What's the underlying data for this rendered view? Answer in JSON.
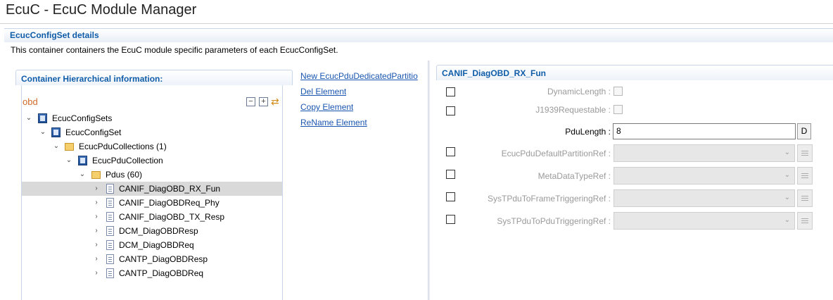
{
  "app_title": "EcuC - EcuC Module Manager",
  "details": {
    "title": "EcucConfigSet details",
    "description": "This container containers the EcuC module specific parameters of each EcucConfigSet."
  },
  "hierarchy": {
    "title": "Container Hierarchical information:",
    "filter": "obd",
    "tree": [
      {
        "label": "EcucConfigSets",
        "icon": "container-icon",
        "twisty": "expanded"
      },
      {
        "label": "EcucConfigSet",
        "icon": "container-icon",
        "twisty": "expanded"
      },
      {
        "label": "EcucPduCollections (1)",
        "icon": "folder-icon",
        "twisty": "expanded"
      },
      {
        "label": "EcucPduCollection",
        "icon": "container-icon",
        "twisty": "expanded"
      },
      {
        "label": "Pdus (60)",
        "icon": "folder-icon",
        "twisty": "expanded"
      },
      {
        "label": "CANIF_DiagOBD_RX_Fun",
        "icon": "document-icon",
        "twisty": "collapsed",
        "selected": true
      },
      {
        "label": "CANIF_DiagOBDReq_Phy",
        "icon": "document-icon",
        "twisty": "collapsed"
      },
      {
        "label": "CANIF_DiagOBD_TX_Resp",
        "icon": "document-icon",
        "twisty": "collapsed"
      },
      {
        "label": "DCM_DiagOBDResp",
        "icon": "document-icon",
        "twisty": "collapsed"
      },
      {
        "label": "DCM_DiagOBDReq",
        "icon": "document-icon",
        "twisty": "collapsed"
      },
      {
        "label": "CANTP_DiagOBDResp",
        "icon": "document-icon",
        "twisty": "collapsed"
      },
      {
        "label": "CANTP_DiagOBDReq",
        "icon": "document-icon",
        "twisty": "collapsed"
      }
    ]
  },
  "actions": {
    "new": "New EcucPduDedicatedPartitio",
    "delete": "Del Element",
    "copy": "Copy Element",
    "rename": "ReName Element"
  },
  "pdu": {
    "title": "CANIF_DiagOBD_RX_Fun",
    "params": {
      "dynamic_length": "DynamicLength :",
      "j1939_requestable": "J1939Requestable :",
      "pdu_length": "PduLength :",
      "pdu_length_value": "8",
      "default_button": "D",
      "default_partition_ref": "EcucPduDefaultPartitionRef :",
      "meta_data_type_ref": "MetaDataTypeRef :",
      "frame_triggering_ref": "SysTPduToFrameTriggeringRef :",
      "pdu_triggering_ref": "SysTPduToPduTriggeringRef :"
    }
  }
}
